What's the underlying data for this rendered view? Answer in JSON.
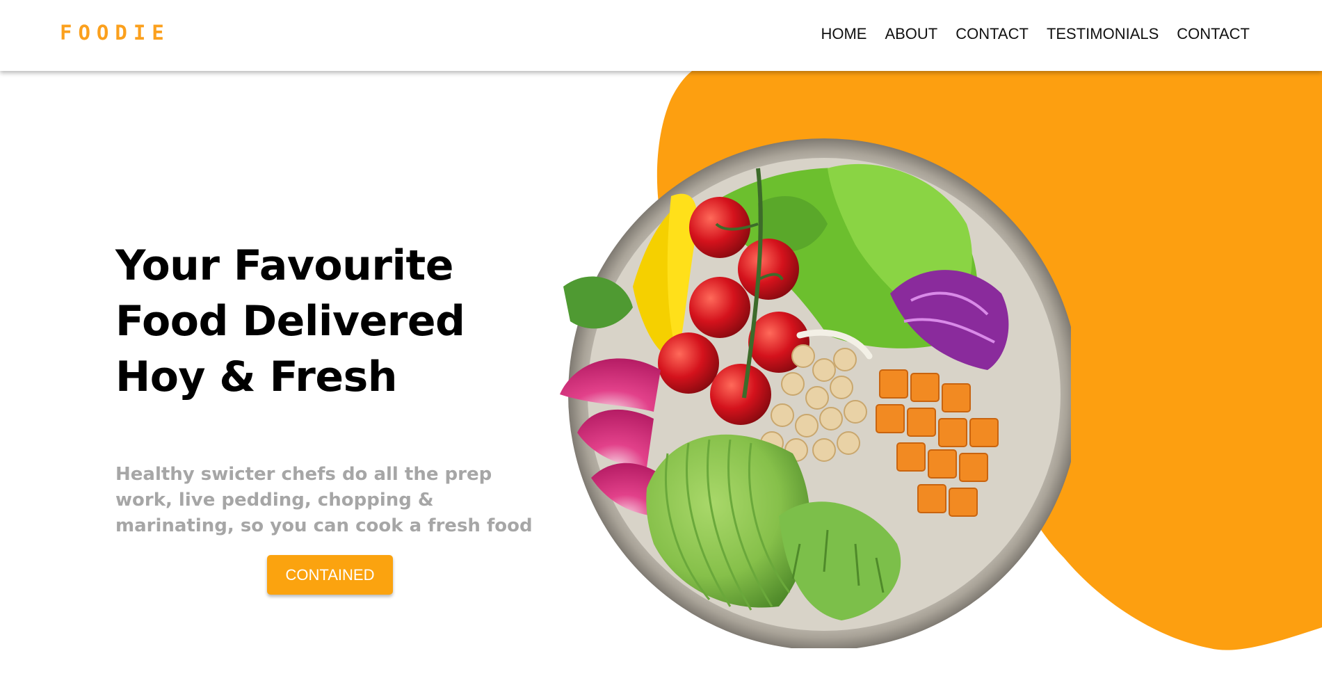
{
  "brand": {
    "logo": "FOODIE",
    "accent_color": "#fba01d"
  },
  "nav": {
    "items": [
      {
        "label": "HOME"
      },
      {
        "label": "ABOUT"
      },
      {
        "label": "CONTACT"
      },
      {
        "label": "TESTIMONIALS"
      },
      {
        "label": "CONTACT"
      }
    ]
  },
  "hero": {
    "title": "Your Favourite Food Delivered Hoy & Fresh",
    "subtitle": "Healthy swicter chefs do all the prep work, live pedding, chopping & marinating, so you can cook a fresh food",
    "cta_label": "CONTAINED",
    "image": "salad-bowl-image"
  }
}
